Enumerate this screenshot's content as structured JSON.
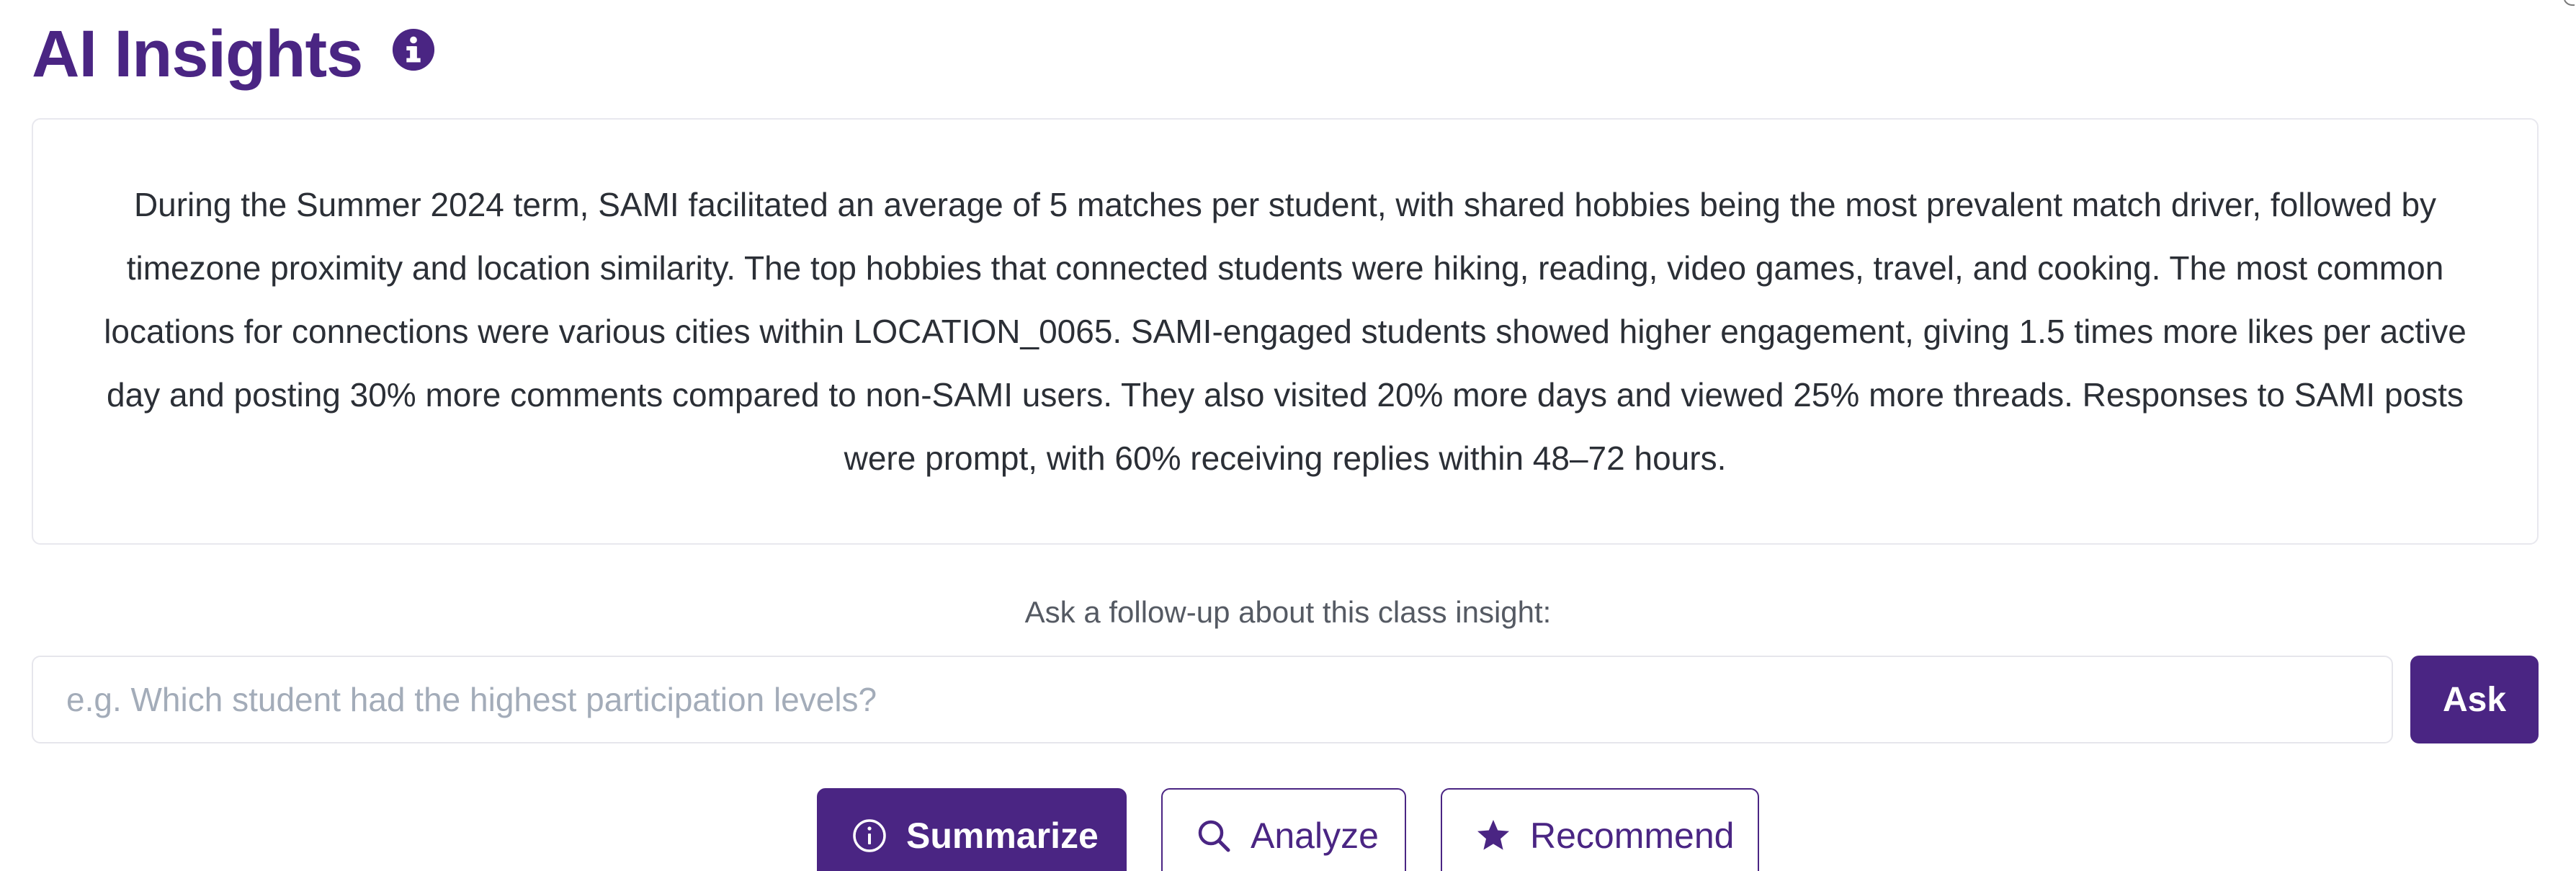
{
  "header": {
    "title": "AI Insights",
    "info_icon": "info-circle-icon"
  },
  "insight": {
    "text": "During the Summer 2024 term, SAMI facilitated an average of 5 matches per student, with shared hobbies being the most prevalent match driver, followed by timezone proximity and location similarity. The top hobbies that connected students were hiking, reading, video games, travel, and cooking. The most common locations for connections were various cities within LOCATION_0065. SAMI-engaged students showed higher engagement, giving 1.5 times more likes per active day and posting 30% more comments compared to non-SAMI users. They also visited 20% more days and viewed 25% more threads. Responses to SAMI posts were prompt, with 60% receiving replies within 48–72 hours."
  },
  "followup": {
    "label": "Ask a follow-up about this class insight:",
    "placeholder": "e.g. Which student had the highest participation levels?",
    "value": "",
    "ask_label": "Ask"
  },
  "actions": [
    {
      "label": "Summarize",
      "icon": "info-circle-outline-icon"
    },
    {
      "label": "Analyze",
      "icon": "search-icon"
    },
    {
      "label": "Recommend",
      "icon": "star-icon"
    }
  ],
  "colors": {
    "brand": "#4a2583",
    "text": "#2b2f36",
    "muted": "#555a63",
    "placeholder": "#a3acb9",
    "border": "#e6e6ec"
  }
}
